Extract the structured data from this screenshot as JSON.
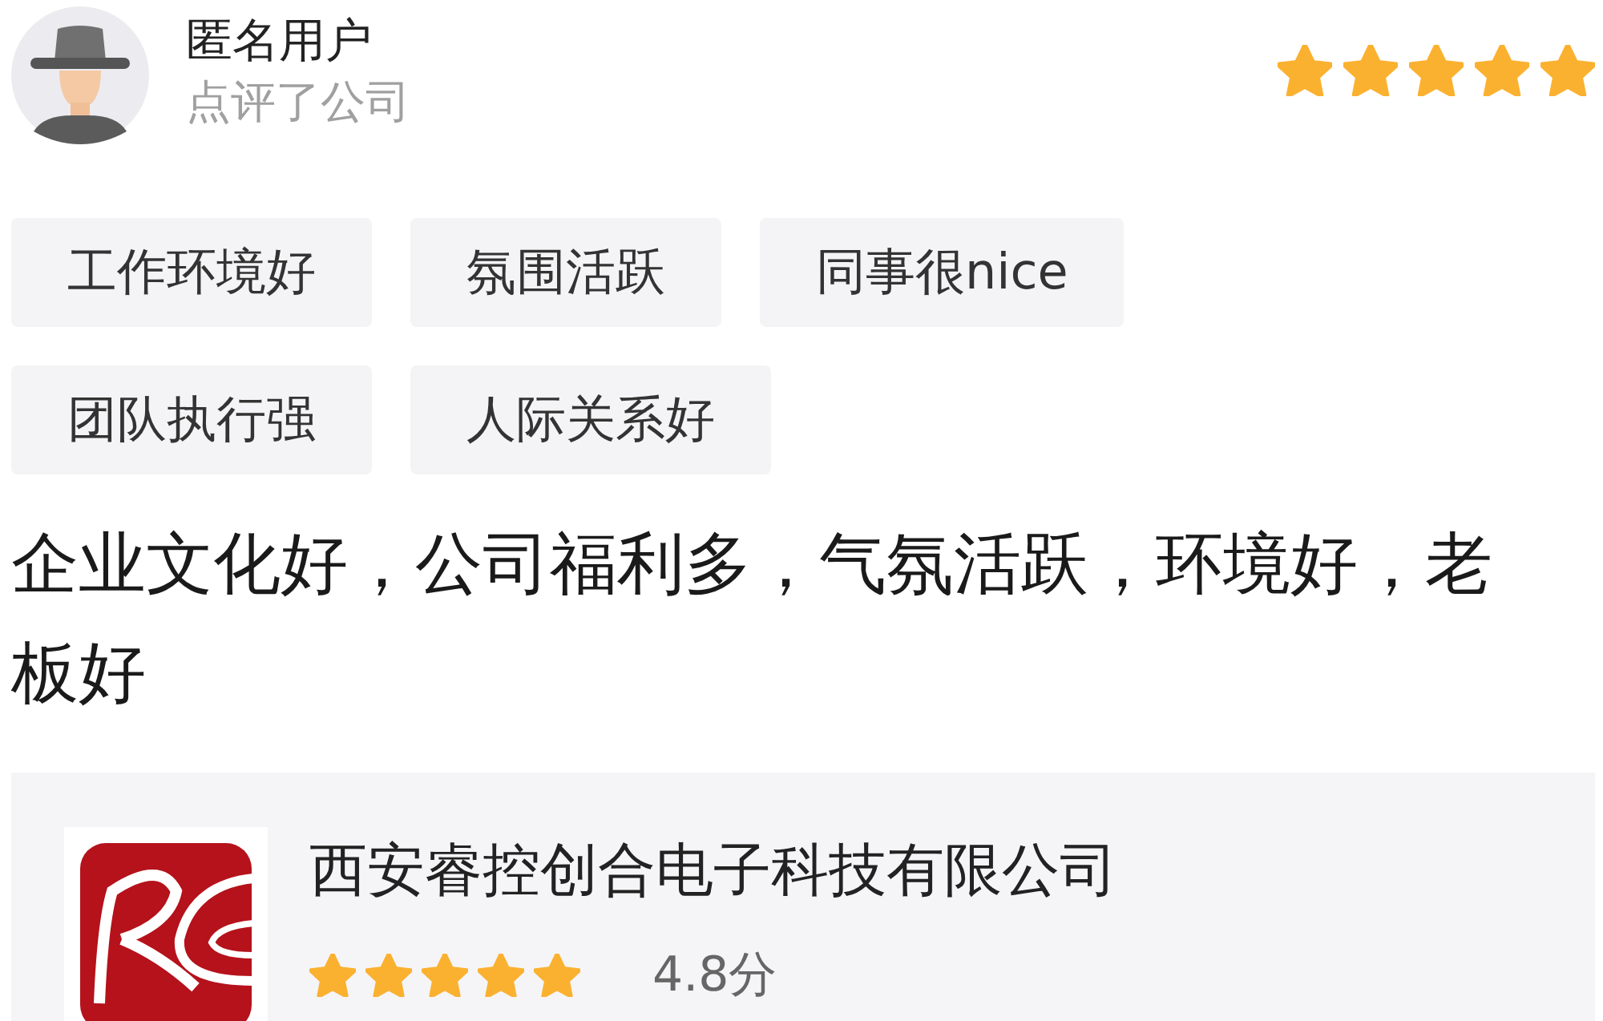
{
  "review": {
    "user_name": "匿名用户",
    "action": "点评了公司",
    "stars": 5,
    "tags": [
      "工作环境好",
      "氛围活跃",
      "同事很nice",
      "团队执行强",
      "人际关系好"
    ],
    "text": "企业文化好，公司福利多，气氛活跃，环境好，老板好"
  },
  "company": {
    "name": "西安睿控创合电子科技有限公司",
    "stars": 5,
    "score": "4.8分"
  }
}
